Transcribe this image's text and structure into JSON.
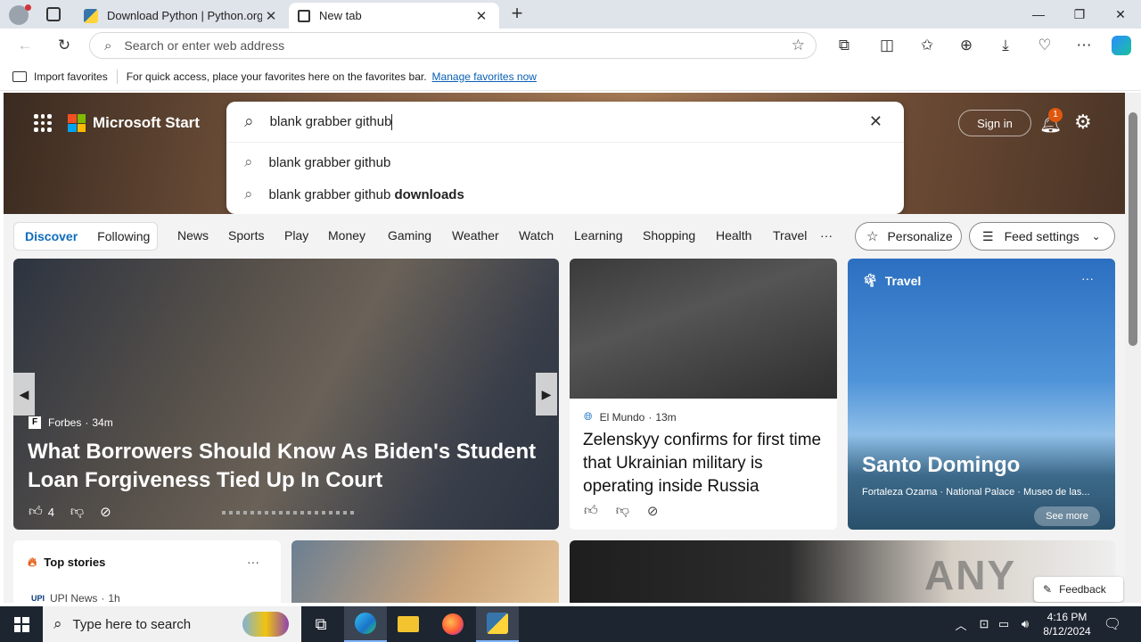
{
  "tabs": [
    {
      "label": "Download Python | Python.org",
      "icon": "python-icon"
    },
    {
      "label": "New tab",
      "icon": "newtab-icon"
    }
  ],
  "address_bar": {
    "placeholder": "Search or enter web address"
  },
  "favorites_bar": {
    "import_label": "Import favorites",
    "message": "For quick access, place your favorites here on the favorites bar.",
    "manage_link": "Manage favorites now"
  },
  "header": {
    "logo_text": "Microsoft Start",
    "search_query": "blank grabber github",
    "suggestions": [
      {
        "prefix": "blank grabber github",
        "bold": ""
      },
      {
        "prefix": "blank grabber github ",
        "bold": "downloads"
      }
    ],
    "sign_in": "Sign in",
    "notification_count": "1"
  },
  "nav": {
    "discover": "Discover",
    "following": "Following",
    "items": [
      "News",
      "Sports",
      "Play",
      "Money",
      "Gaming",
      "Weather",
      "Watch",
      "Learning",
      "Shopping",
      "Health",
      "Travel"
    ],
    "more": "···",
    "personalize": "Personalize",
    "feed_settings": "Feed settings"
  },
  "cards": {
    "main": {
      "source": "Forbes",
      "age": "34m",
      "title": "What Borrowers Should Know As Biden's Student Loan Forgiveness Tied Up In Court",
      "likes": "4"
    },
    "second": {
      "source": "El Mundo",
      "age": "13m",
      "title": "Zelenskyy confirms for first time that Ukrainian military is operating inside Russia"
    },
    "travel": {
      "category": "Travel",
      "title": "Santo Domingo",
      "subtitle": "Fortaleza Ozama · National Palace · Museo de las...",
      "see_more": "See more"
    },
    "top_stories": {
      "heading": "Top stories",
      "source": "UPI News",
      "age": "1h"
    },
    "watermark": "ANY RUN",
    "feedback": "Feedback"
  },
  "taskbar": {
    "search_placeholder": "Type here to search",
    "time": "4:16 PM",
    "date": "8/12/2024"
  }
}
